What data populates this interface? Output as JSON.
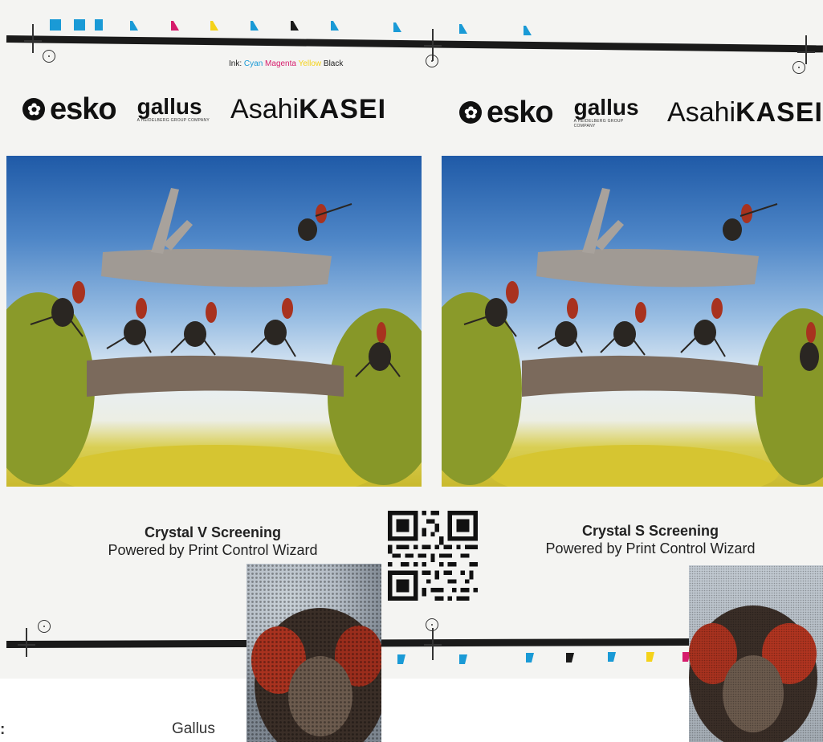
{
  "ink_label": {
    "prefix": "Ink:",
    "cyan": "Cyan",
    "magenta": "Magenta",
    "yellow": "Yellow",
    "black": "Black"
  },
  "logos": {
    "esko": "esko",
    "gallus": "gallus",
    "gallus_tagline": "A HEIDELBERG GROUP COMPANY",
    "asahi_light": "Asahi",
    "asahi_bold": "KASEI"
  },
  "panels": [
    {
      "caption_title": "Crystal V Screening",
      "caption_sub": "Powered by Print Control Wizard"
    },
    {
      "caption_title": "Crystal S Screening",
      "caption_sub": "Powered by Print Control Wizard"
    }
  ],
  "colors": {
    "cyan": "#1a9ad6",
    "magenta": "#d61c6c",
    "yellow": "#f4d21a",
    "black": "#1a1a1a",
    "ant_red": "#a8321f",
    "ant_dark": "#2a2622",
    "moss": "#8a9a2a",
    "branch": "#7b6a5c"
  },
  "footer": {
    "left_partial": ":",
    "right": "Gallus"
  },
  "icons": [
    "esko-logo-icon",
    "qr-code",
    "registration-mark-icon"
  ]
}
